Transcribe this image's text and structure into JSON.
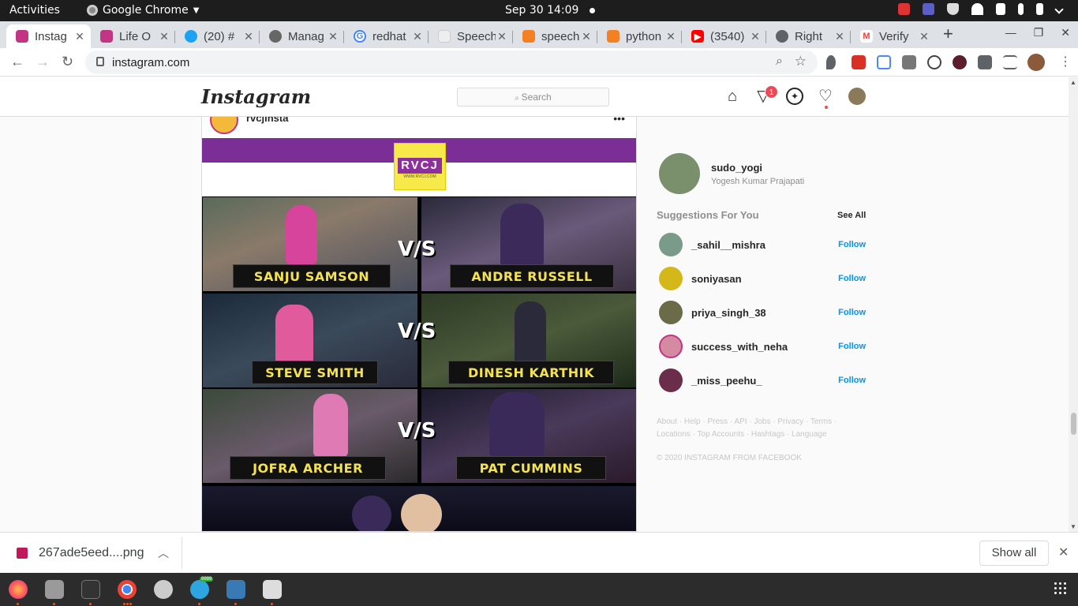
{
  "topbar": {
    "activities": "Activities",
    "app": "Google Chrome",
    "clock": "Sep 30  14:09"
  },
  "tabs": [
    {
      "label": "Instag",
      "icon": "instagram-icon",
      "color": "#c13584"
    },
    {
      "label": "Life O",
      "icon": "instagram-icon",
      "color": "#c13584"
    },
    {
      "label": "(20) #",
      "icon": "twitter-icon",
      "color": "#1da1f2"
    },
    {
      "label": "Manag",
      "icon": "apple-icon",
      "color": "#666666"
    },
    {
      "label": "redhat",
      "icon": "google-icon",
      "color": "#4285f4"
    },
    {
      "label": "Speech",
      "icon": "doc-icon",
      "color": "#dddddd"
    },
    {
      "label": "speech",
      "icon": "stackoverflow-icon",
      "color": "#f48024"
    },
    {
      "label": "python",
      "icon": "stackoverflow-icon",
      "color": "#f48024"
    },
    {
      "label": "(3540)",
      "icon": "youtube-icon",
      "color": "#ff0000"
    },
    {
      "label": "Right",
      "icon": "globe-icon",
      "color": "#5f6368"
    },
    {
      "label": "Verify",
      "icon": "gmail-icon",
      "color": "#ea4335"
    }
  ],
  "address": {
    "url": "instagram.com"
  },
  "instagram": {
    "logo": "Instagram",
    "search_placeholder": "Search",
    "activity_badge": "1"
  },
  "post": {
    "author": "rvcjinsta",
    "brand": "RVCJ",
    "brand_sub": "WWW.RVCJ.COM",
    "matchups": [
      {
        "left": "SANJU SAMSON",
        "right": "ANDRE RUSSELL",
        "vs": "V/S"
      },
      {
        "left": "STEVE SMITH",
        "right": "DINESH KARTHIK",
        "vs": "V/S"
      },
      {
        "left": "JOFRA ARCHER",
        "right": "PAT CUMMINS",
        "vs": "V/S"
      }
    ]
  },
  "sidebar": {
    "username": "sudo_yogi",
    "fullname": "Yogesh Kumar Prajapati",
    "suggestions_title": "Suggestions For You",
    "see_all": "See All",
    "follow_label": "Follow",
    "suggestions": [
      {
        "username": "_sahil__mishra",
        "color": "#7a9a8a"
      },
      {
        "username": "soniyasan",
        "color": "#d4b81a"
      },
      {
        "username": "priya_singh_38",
        "color": "#6b6b4a"
      },
      {
        "username": "success_with_neha",
        "color": "#d48aa0"
      },
      {
        "username": "_miss_peehu_",
        "color": "#6a2e4a"
      }
    ],
    "footer_links_1": "About · Help · Press · API · Jobs · Privacy · Terms ·",
    "footer_links_2": "Locations · Top Accounts · Hashtags · Language",
    "copyright": "© 2020 INSTAGRAM FROM FACEBOOK"
  },
  "download": {
    "filename": "267ade5eed....png",
    "show_all": "Show all"
  },
  "taskbar": {
    "telegram_badge": "9999"
  }
}
